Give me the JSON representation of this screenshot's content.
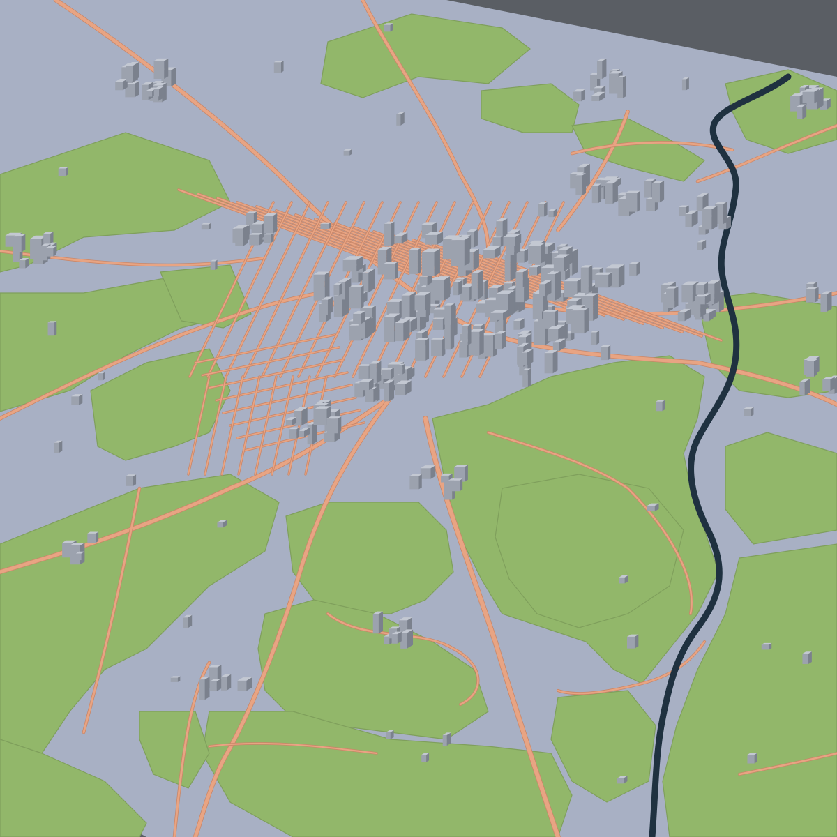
{
  "scene": {
    "kind": "3d-city-map-model",
    "labels_visible": false
  },
  "colors": {
    "background": "#5a5e64",
    "base_top": "#a8b0c4",
    "base_side": "#8c92a1",
    "park": "#92b76a",
    "park_edge": "#7f9f5c",
    "road": "#e8a483",
    "road_edge": "#c98668",
    "river": "#1f3140",
    "building": "#9ca2ae",
    "building_shade": "#7b818d",
    "building_roof": "#c3c8d2"
  },
  "layers": [
    {
      "name": "terrain-base",
      "icon": "map-base-icon"
    },
    {
      "name": "green-areas",
      "icon": "park-icon"
    },
    {
      "name": "river",
      "icon": "river-icon"
    },
    {
      "name": "road-network",
      "icon": "road-icon"
    },
    {
      "name": "buildings",
      "icon": "building-icon"
    }
  ]
}
